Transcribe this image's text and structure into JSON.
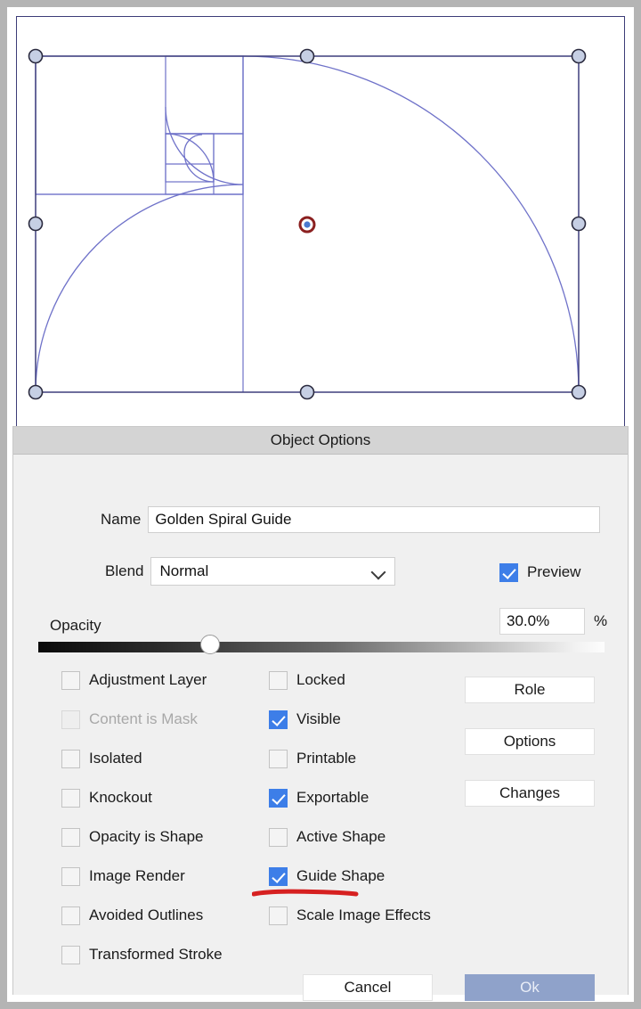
{
  "window": {
    "frame_color": "#b4b4b4",
    "canvas_background": "#ffffff"
  },
  "canvas": {
    "name": "golden-spiral-guide-canvas",
    "guide_color": "#6f72c9",
    "selection_border_color": "#3c3c78",
    "handle_fill": "#c6cfe4",
    "handle_stroke": "#2b2b3f",
    "pivot_outer_color": "#8b2020",
    "pivot_inner_color": "#4a7ad0",
    "handle_count": 8
  },
  "dialog": {
    "title": "Object Options",
    "name_field": {
      "label": "Name",
      "value": "Golden Spiral Guide",
      "placeholder": "Object name"
    },
    "blend_field": {
      "label": "Blend",
      "value": "Normal",
      "options": [
        "Normal"
      ]
    },
    "preview": {
      "label": "Preview",
      "checked": true
    },
    "opacity": {
      "label": "Opacity",
      "value": "30.0%",
      "unit": "%",
      "percent": 30
    },
    "checkbox_column_left": [
      {
        "label": "Adjustment Layer",
        "checked": false,
        "disabled": false
      },
      {
        "label": "Content is Mask",
        "checked": false,
        "disabled": true
      },
      {
        "label": "Isolated",
        "checked": false,
        "disabled": false
      },
      {
        "label": "Knockout",
        "checked": false,
        "disabled": false
      },
      {
        "label": "Opacity is Shape",
        "checked": false,
        "disabled": false
      },
      {
        "label": "Image Render",
        "checked": false,
        "disabled": false
      },
      {
        "label": "Avoided Outlines",
        "checked": false,
        "disabled": false
      },
      {
        "label": "Transformed Stroke",
        "checked": false,
        "disabled": false
      }
    ],
    "checkbox_column_middle": [
      {
        "label": "Locked",
        "checked": false,
        "disabled": false
      },
      {
        "label": "Visible",
        "checked": true,
        "disabled": false
      },
      {
        "label": "Printable",
        "checked": false,
        "disabled": false
      },
      {
        "label": "Exportable",
        "checked": true,
        "disabled": false
      },
      {
        "label": "Active Shape",
        "checked": false,
        "disabled": false
      },
      {
        "label": "Guide Shape",
        "checked": true,
        "disabled": false
      },
      {
        "label": "Scale Image Effects",
        "checked": false,
        "disabled": false
      }
    ],
    "side_buttons": [
      {
        "label": "Role"
      },
      {
        "label": "Options"
      },
      {
        "label": "Changes"
      }
    ],
    "footer": {
      "cancel_label": "Cancel",
      "ok_label": "Ok",
      "ok_color": "#8fa2ca"
    },
    "annotation": {
      "target": "Guide Shape",
      "color": "#d62020",
      "kind": "hand-drawn-underline"
    }
  }
}
